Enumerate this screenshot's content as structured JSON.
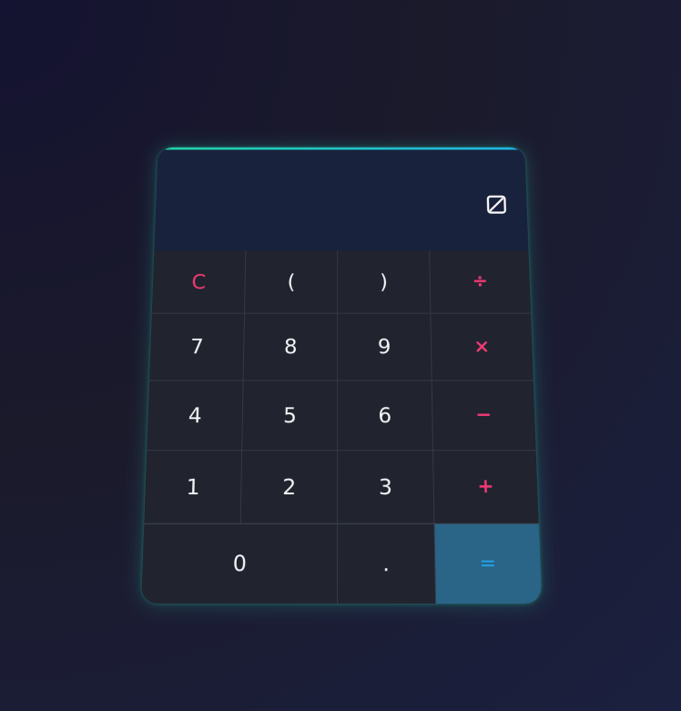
{
  "display": {
    "value": "",
    "theme_toggle_icon": "contrast-square-icon"
  },
  "keys": {
    "clear": "C",
    "paren_open": "(",
    "paren_close": ")",
    "divide": "÷",
    "seven": "7",
    "eight": "8",
    "nine": "9",
    "multiply": "×",
    "four": "4",
    "five": "5",
    "six": "6",
    "minus": "−",
    "one": "1",
    "two": "2",
    "three": "3",
    "plus": "+",
    "zero": "0",
    "dot": ".",
    "equals": "="
  },
  "colors": {
    "accent_operator": "#ef3a74",
    "accent_equals": "#22a4e8",
    "glow_top": "#22d3a6"
  }
}
